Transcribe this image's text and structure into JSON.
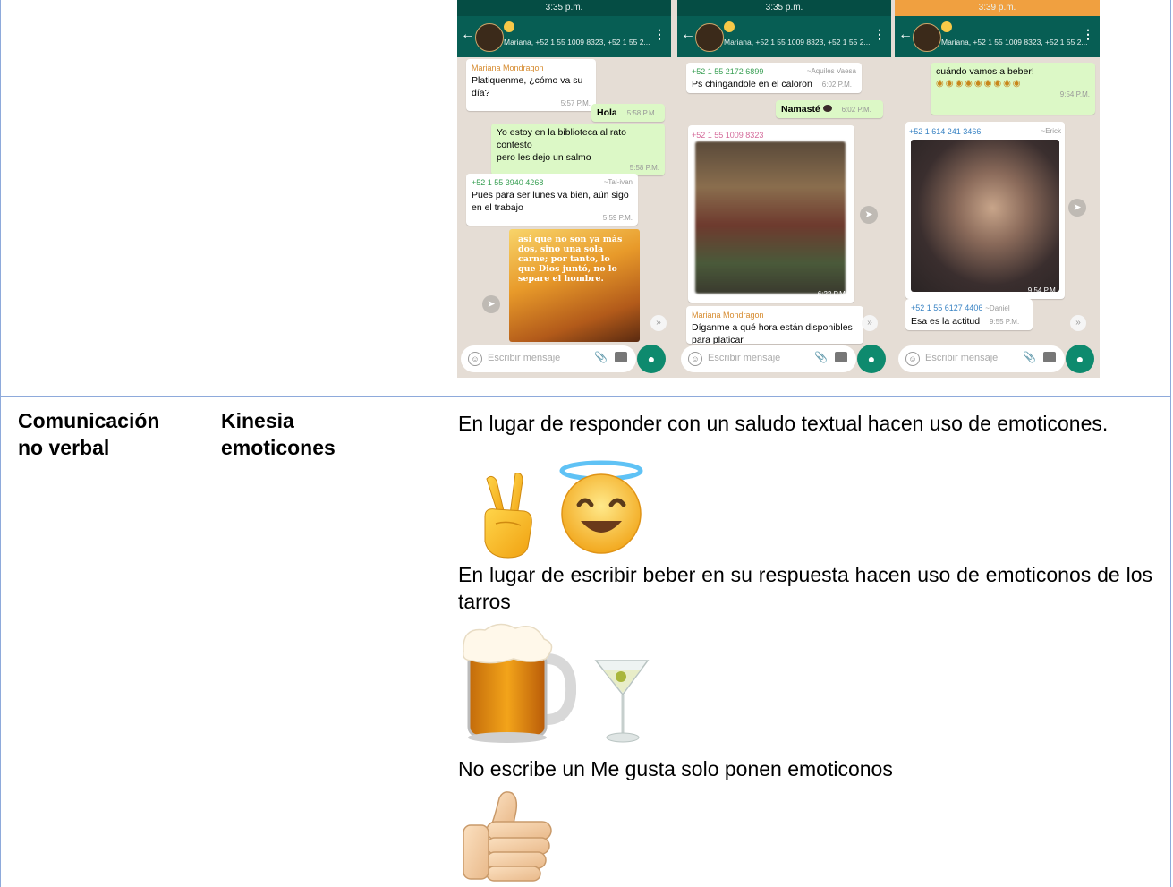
{
  "table": {
    "row": {
      "category": "Comunicación no verbal",
      "category_line1": "Comunicación",
      "category_line2": "no verbal",
      "subcategory_line1": "Kinesia",
      "subcategory_line2": "emoticones",
      "para1": "En lugar de responder con un saludo textual hacen uso de emoticones.",
      "para2": "En lugar de escribir beber en su respuesta hacen uso de emoticonos de los tarros",
      "para3": "No escribe  un Me gusta solo ponen emoticonos"
    }
  },
  "screenshots": {
    "phone1": {
      "status_time": "3:35 p.m.",
      "subtitle": "Mariana, +52 1 55 1009 8323, +52 1 55 2...",
      "messages": [
        {
          "sender": "Mariana Mondragon",
          "text": "Platiquenme, ¿cómo va su día?",
          "time": "5:57 P.M."
        },
        {
          "text": "Hola",
          "time": "5:58 P.M."
        },
        {
          "text": "Yo estoy en la biblioteca al rato contesto",
          "text2": "pero les dejo un salmo",
          "time": "5:58 P.M."
        },
        {
          "sender": "+52 1 55 3940 4268",
          "alias": "~Tal-ivan",
          "text": "Pues para ser lunes va bien, aún sigo en el trabajo",
          "time": "5:59 P.M."
        }
      ],
      "image_caption": "así que no son ya más dos, sino una sola carne; por tanto, lo que Dios juntó, no lo separe el hombre.",
      "input_placeholder": "Escribir mensaje"
    },
    "phone2": {
      "status_time": "3:35 p.m.",
      "subtitle": "Mariana, +52 1 55 1009 8323, +52 1 55 2...",
      "messages": [
        {
          "sender": "+52 1 55 2172 6899",
          "alias": "~Aquiles Vaesa",
          "text": "Ps chingandole en el caloron",
          "time": "6:02 P.M."
        },
        {
          "text": "Namasté",
          "time": "6:02 P.M."
        },
        {
          "sender": "+52 1 55 1009 8323",
          "time": "6:22 P.M."
        },
        {
          "sender": "Mariana Mondragon",
          "text": "Díganme a qué hora están disponibles para platicar"
        }
      ],
      "input_placeholder": "Escribir mensaje"
    },
    "phone3": {
      "status_time": "3:39 p.m.",
      "subtitle": "Mariana, +52 1 55 1009 8323, +52 1 55 2...",
      "messages": [
        {
          "text": "cuándo vamos a beber!",
          "time": "9:54 P.M."
        },
        {
          "sender": "+52 1 614 241 3466",
          "alias": "~Erick",
          "time": "9:54 P.M."
        },
        {
          "sender": "+52 1 55 6127 4406",
          "alias": "~Daniel",
          "text": "Esa es la actitud",
          "time": "9:55 P.M."
        }
      ],
      "input_placeholder": "Escribir mensaje"
    }
  },
  "colors": {
    "border": "#8eaadb",
    "whatsapp_header": "#075e54",
    "chat_background": "#e5ddd5",
    "outgoing_bubble": "#dcf8c6"
  }
}
